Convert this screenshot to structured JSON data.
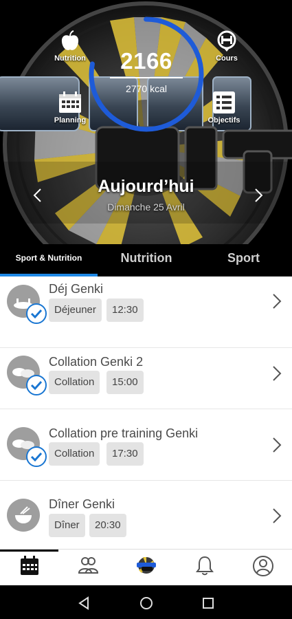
{
  "hero": {
    "calories_consumed": "2166",
    "calories_target": "2770 kcal",
    "day_label": "Aujourd’hui",
    "date_label": "Dimanche 25 Avril",
    "quick_links": {
      "nutrition": "Nutrition",
      "cours": "Cours",
      "planning": "Planning",
      "objectifs": "Objectifs"
    },
    "progress_fraction": 0.78
  },
  "tabs": {
    "active": "Sport & Nutrition",
    "items": [
      "Sport & Nutrition",
      "Nutrition",
      "Sport"
    ]
  },
  "meals": [
    {
      "title": "Déj Genki",
      "type": "Déjeuner",
      "time": "12:30",
      "completed": true,
      "icon": "plate-icon"
    },
    {
      "title": "Collation Genki 2",
      "type": "Collation",
      "time": "15:00",
      "completed": true,
      "icon": "cookies-icon"
    },
    {
      "title": "Collation pre training Genki",
      "type": "Collation",
      "time": "17:30",
      "completed": true,
      "icon": "cookies-icon"
    },
    {
      "title": "Dîner Genki",
      "type": "Dîner",
      "time": "20:30",
      "completed": false,
      "icon": "bowl-icon"
    }
  ],
  "bottom_nav": [
    "calendar-icon",
    "community-icon",
    "genki-logo-icon",
    "bell-icon",
    "profile-icon"
  ],
  "colors": {
    "accent": "#1e88e5",
    "check": "#1976d2",
    "chip_bg": "#e3e3e3",
    "text": "#4a4a4a"
  }
}
